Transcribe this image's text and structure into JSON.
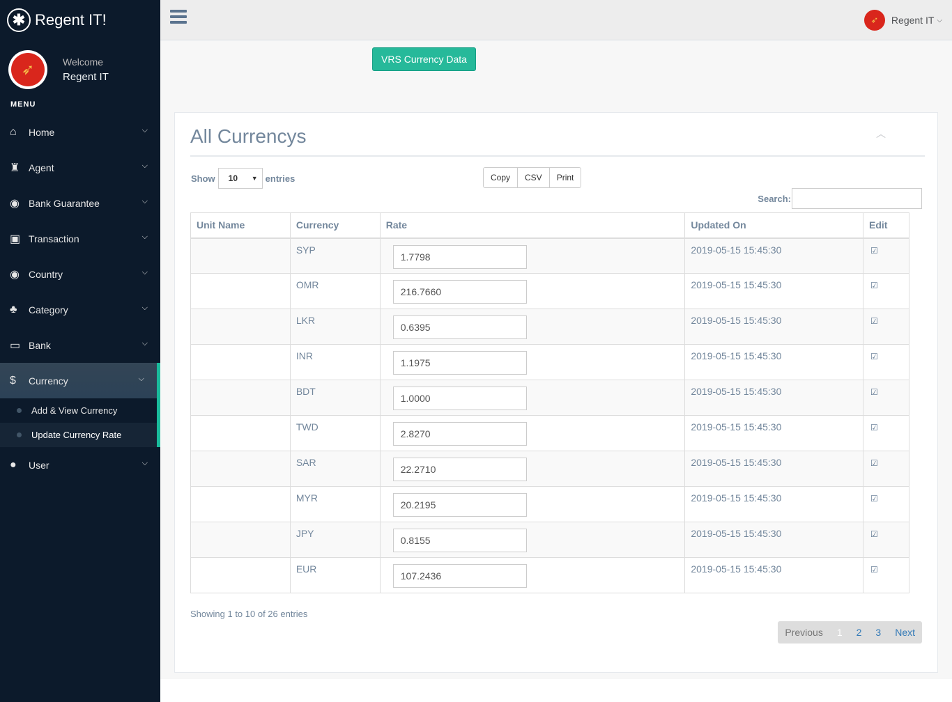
{
  "brand": {
    "logo_glyph": "✱",
    "title": "Regent IT!"
  },
  "profile": {
    "welcome": "Welcome",
    "name": "Regent IT"
  },
  "menu_title": "MENU",
  "nav": [
    {
      "label": "Home",
      "icon": "home-icon",
      "glyph": "⌂"
    },
    {
      "label": "Agent",
      "icon": "agent-icon",
      "glyph": "♜"
    },
    {
      "label": "Bank Guarantee",
      "icon": "globe-icon",
      "glyph": "◉"
    },
    {
      "label": "Transaction",
      "icon": "money-icon",
      "glyph": "▣"
    },
    {
      "label": "Country",
      "icon": "globe-icon",
      "glyph": "◉"
    },
    {
      "label": "Category",
      "icon": "tree-icon",
      "glyph": "♣"
    },
    {
      "label": "Bank",
      "icon": "credit-card-icon",
      "glyph": "▭"
    },
    {
      "label": "Currency",
      "icon": "dollar-icon",
      "glyph": "$"
    },
    {
      "label": "User",
      "icon": "user-icon",
      "glyph": "●"
    }
  ],
  "currency_sub": [
    "Add & View Currency",
    "Update Currency Rate"
  ],
  "topnav": {
    "user": "Regent IT"
  },
  "vrs_button": "VRS Currency Data",
  "panel": {
    "title": "All Currencys",
    "show": "Show",
    "entries_value": "10",
    "entries": "entries",
    "buttons": [
      "Copy",
      "CSV",
      "Print"
    ],
    "search_label": "Search:"
  },
  "table": {
    "headers": [
      "Unit Name",
      "Currency",
      "Rate",
      "Updated On",
      "Edit"
    ],
    "rows": [
      {
        "unit": "",
        "currency": "SYP",
        "rate": "1.7798",
        "updated": "2019-05-15 15:45:30"
      },
      {
        "unit": "",
        "currency": "OMR",
        "rate": "216.7660",
        "updated": "2019-05-15 15:45:30"
      },
      {
        "unit": "",
        "currency": "LKR",
        "rate": "0.6395",
        "updated": "2019-05-15 15:45:30"
      },
      {
        "unit": "",
        "currency": "INR",
        "rate": "1.1975",
        "updated": "2019-05-15 15:45:30"
      },
      {
        "unit": "",
        "currency": "BDT",
        "rate": "1.0000",
        "updated": "2019-05-15 15:45:30"
      },
      {
        "unit": "",
        "currency": "TWD",
        "rate": "2.8270",
        "updated": "2019-05-15 15:45:30"
      },
      {
        "unit": "",
        "currency": "SAR",
        "rate": "22.2710",
        "updated": "2019-05-15 15:45:30"
      },
      {
        "unit": "",
        "currency": "MYR",
        "rate": "20.2195",
        "updated": "2019-05-15 15:45:30"
      },
      {
        "unit": "",
        "currency": "JPY",
        "rate": "0.8155",
        "updated": "2019-05-15 15:45:30"
      },
      {
        "unit": "",
        "currency": "EUR",
        "rate": "107.2436",
        "updated": "2019-05-15 15:45:30"
      }
    ]
  },
  "info": "Showing 1 to 10 of 26 entries",
  "pager": {
    "previous": "Previous",
    "pages": [
      "1",
      "2",
      "3"
    ],
    "next": "Next"
  }
}
